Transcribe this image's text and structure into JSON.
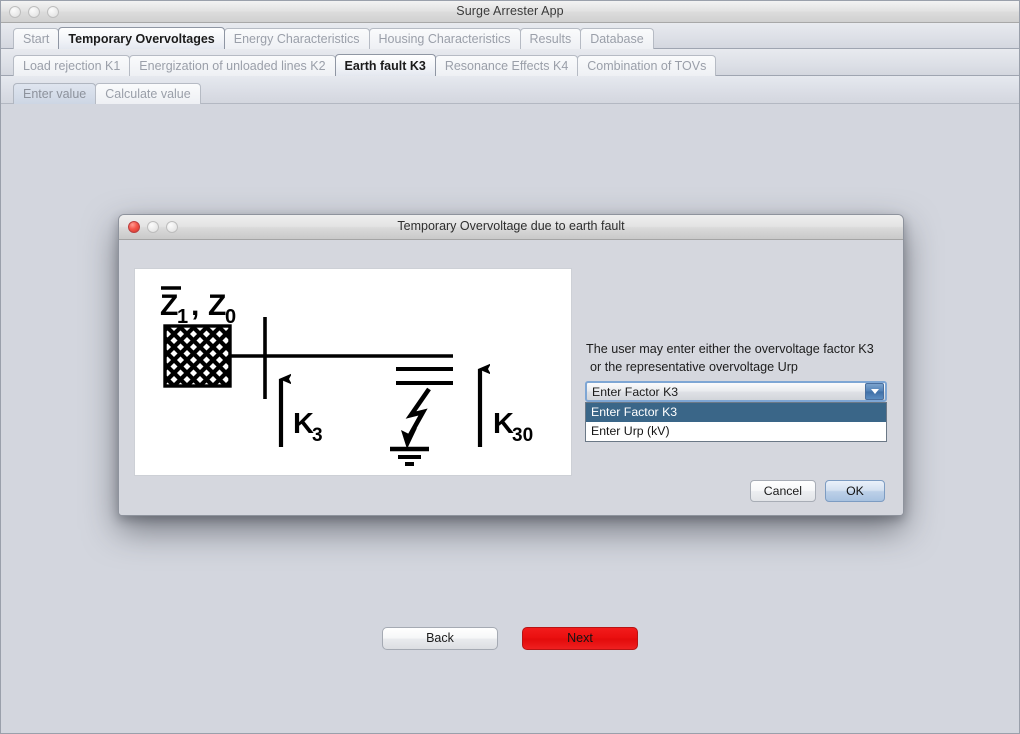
{
  "window": {
    "title": "Surge Arrester App",
    "traffic_lights": [
      "close",
      "minimize",
      "zoom"
    ]
  },
  "tabs_primary": [
    {
      "label": "Start",
      "selected": false
    },
    {
      "label": "Temporary Overvoltages",
      "selected": true
    },
    {
      "label": "Energy Characteristics",
      "selected": false
    },
    {
      "label": "Housing Characteristics",
      "selected": false
    },
    {
      "label": "Results",
      "selected": false
    },
    {
      "label": "Database",
      "selected": false
    }
  ],
  "tabs_secondary": [
    {
      "label": "Load rejection K1",
      "selected": false
    },
    {
      "label": "Energization of unloaded lines K2",
      "selected": false
    },
    {
      "label": "Earth fault K3",
      "selected": true
    },
    {
      "label": "Resonance Effects K4",
      "selected": false
    },
    {
      "label": "Combination of TOVs",
      "selected": false
    }
  ],
  "tabs_tertiary": [
    {
      "label": "Enter value",
      "selected": true
    },
    {
      "label": "Calculate value",
      "selected": false
    }
  ],
  "dialog": {
    "title": "Temporary Overvoltage due to earth fault",
    "traffic_lights": [
      "close",
      "minimize",
      "zoom"
    ],
    "prompt_line1": "The user may enter either the overvoltage factor K3",
    "prompt_line2": "or the representative overvoltage Urp",
    "combo": {
      "selected": "Enter Factor K3",
      "expanded": true,
      "options": [
        {
          "label": "Enter Factor K3",
          "highlighted": true
        },
        {
          "label": "Enter Urp (kV)",
          "highlighted": false
        }
      ]
    },
    "buttons": {
      "cancel": "Cancel",
      "ok": "OK"
    },
    "diagram": {
      "impedance_label_z1": "Z",
      "impedance_label_z1_sub": "1",
      "impedance_separator": ",",
      "impedance_label_z0": "Z",
      "impedance_label_z0_sub": "0",
      "arrow_left_label": "K",
      "arrow_left_sub": "3",
      "arrow_right_label": "K",
      "arrow_right_sub": "30"
    }
  },
  "navigation": {
    "back": "Back",
    "next": "Next"
  },
  "colors": {
    "app_background": "#d3d6de",
    "dialog_background": "#d5d7de",
    "selection_blue": "#3a6688",
    "next_button_red": "#ea0f0f",
    "focus_border_blue": "#7ea6d4"
  }
}
